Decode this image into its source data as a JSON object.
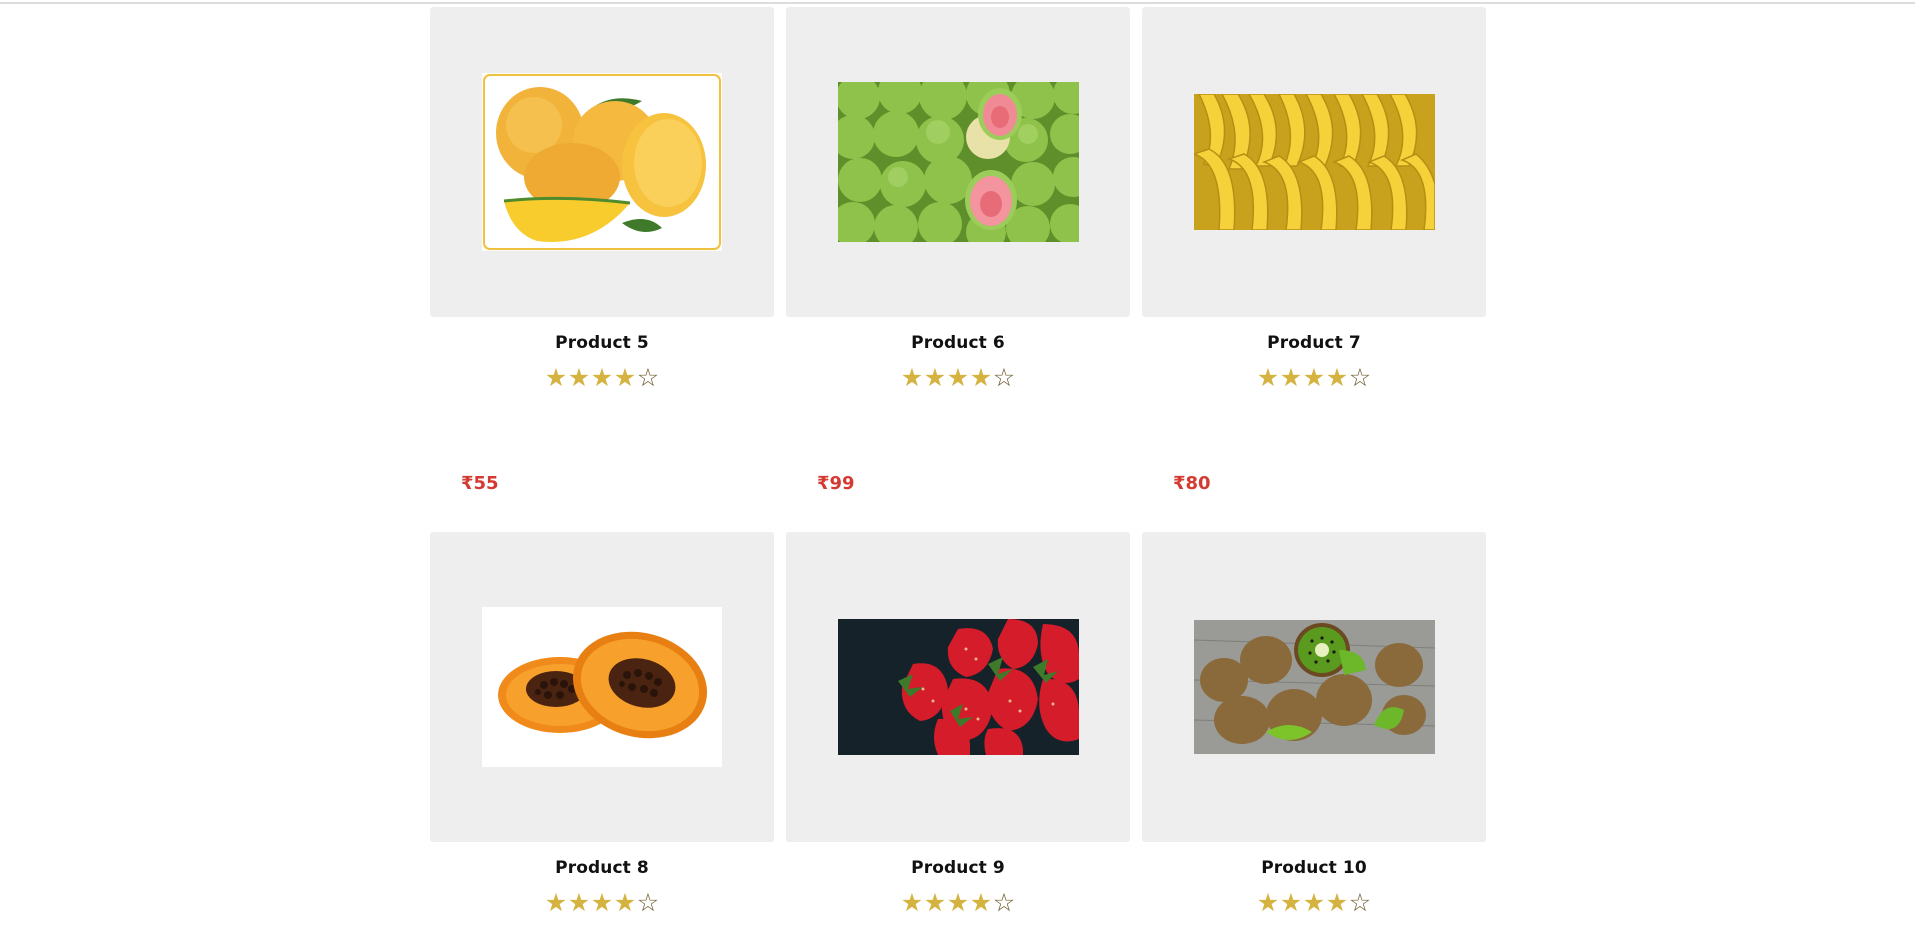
{
  "products": [
    {
      "name": "Product 5",
      "rating": 4,
      "max_rating": 5,
      "price": "₹55",
      "image": "mangoes"
    },
    {
      "name": "Product 6",
      "rating": 4,
      "max_rating": 5,
      "price": "₹99",
      "image": "guavas"
    },
    {
      "name": "Product 7",
      "rating": 4,
      "max_rating": 5,
      "price": "₹80",
      "image": "bananas"
    },
    {
      "name": "Product 8",
      "rating": 4,
      "max_rating": 5,
      "image": "papaya"
    },
    {
      "name": "Product 9",
      "rating": 4,
      "max_rating": 5,
      "image": "strawberries"
    },
    {
      "name": "Product 10",
      "rating": 4,
      "max_rating": 5,
      "image": "kiwis"
    }
  ],
  "colors": {
    "price": "#d43a32",
    "star_filled": "#d4b340",
    "card_background": "#eeeeee"
  }
}
